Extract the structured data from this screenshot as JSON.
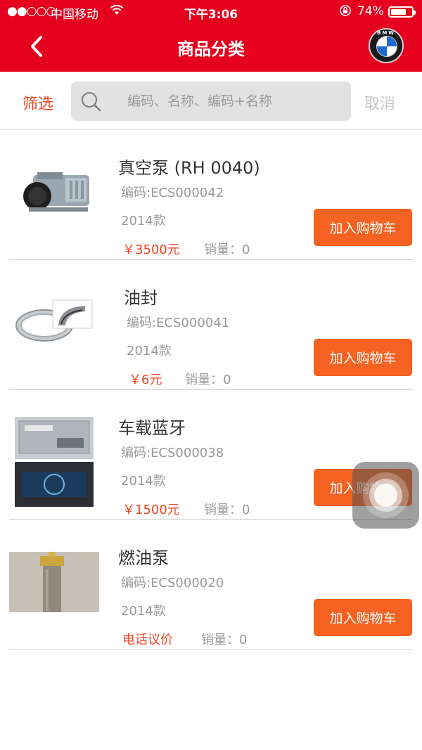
{
  "status_bar": {
    "signal_dots": "●●○○○",
    "carrier": "中国移动",
    "time": "下午3:06",
    "battery_percent": "74%",
    "battery_level": 0.74
  },
  "header": {
    "title": "商品分类",
    "brand_badge": "BMW",
    "background_color": "#e6001f"
  },
  "search": {
    "filter_label": "筛选",
    "placeholder": "编码、名称、编码+名称",
    "cancel_label": "取消"
  },
  "products": [
    {
      "name": "真空泵 (RH 0040)",
      "code": "编码:ECS000042",
      "year": "2014款",
      "price": "￥3500元",
      "sales": "销量：0",
      "button": "加入购物车"
    },
    {
      "name": "油封",
      "code": "编码:ECS000041",
      "year": "2014款",
      "price": "￥6元",
      "sales": "销量：0",
      "button": "加入购物车"
    },
    {
      "name": "车载蓝牙",
      "code": "编码:ECS000038",
      "year": "2014款",
      "price": "￥1500元",
      "sales": "销量：0",
      "button": "加入购物车"
    },
    {
      "name": "燃油泵",
      "code": "编码:ECS000020",
      "year": "2014款",
      "price": "电话议价",
      "sales": "销量：0",
      "button": "加入购物车"
    }
  ],
  "colors": {
    "accent": "#f04423",
    "button": "#f56221",
    "brand_red": "#e6001f"
  }
}
